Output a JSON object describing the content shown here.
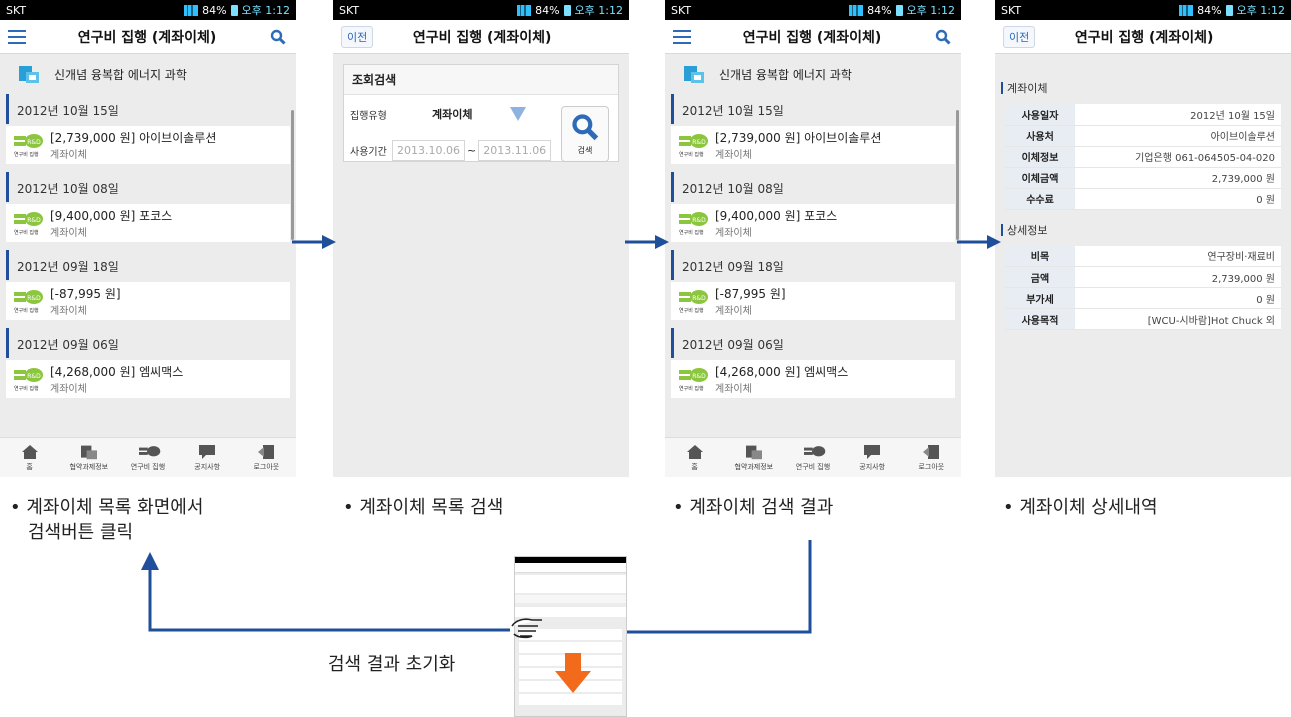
{
  "status": {
    "carrier": "SKT",
    "battery": "84%",
    "time": "오후 1:12"
  },
  "list_screen": {
    "title": "연구비 집행 (계좌이체)",
    "project": "신개념 융복합 에너지 과학",
    "groups": [
      {
        "date": "2012년 10월 15일",
        "amount": "[2,739,000 원] 아이브이솔루션",
        "type": "계좌이체"
      },
      {
        "date": "2012년 10월 08일",
        "amount": "[9,400,000 원] 포코스",
        "type": "계좌이체"
      },
      {
        "date": "2012년 09월 18일",
        "amount": "[-87,995 원]",
        "type": "계좌이체"
      },
      {
        "date": "2012년 09월 06일",
        "amount": "[4,268,000 원] 엠씨맥스",
        "type": "계좌이체"
      }
    ],
    "badge": "연구비 집행"
  },
  "nav": [
    {
      "label": "홈",
      "icon": "home-icon"
    },
    {
      "label": "협약과제정보",
      "icon": "project-info-icon"
    },
    {
      "label": "연구비 집행",
      "icon": "rnd-expense-icon"
    },
    {
      "label": "공지사항",
      "icon": "notice-icon"
    },
    {
      "label": "로그아웃",
      "icon": "logout-icon"
    }
  ],
  "search_screen": {
    "back": "이전",
    "title": "연구비 집행 (계좌이체)",
    "panel_title": "조회검색",
    "type_label": "집행유형",
    "type_value": "계좌이체",
    "period_label": "사용기간",
    "date_from": "2013.10.06",
    "tilde": "~",
    "date_to": "2013.11.06",
    "search_btn": "검색"
  },
  "detail_screen": {
    "back": "이전",
    "title": "연구비 집행 (계좌이체)",
    "section1": "계좌이체",
    "rows1": [
      {
        "k": "사용일자",
        "v": "2012년 10월 15일"
      },
      {
        "k": "사용처",
        "v": "아이브이솔루션"
      },
      {
        "k": "이체정보",
        "v": "기업은행 061-064505-04-020"
      },
      {
        "k": "이체금액",
        "v": "2,739,000 원"
      },
      {
        "k": "수수료",
        "v": "0 원"
      }
    ],
    "section2": "상세정보",
    "rows2": [
      {
        "k": "비목",
        "v": "연구장비·재료비"
      },
      {
        "k": "금액",
        "v": "2,739,000 원"
      },
      {
        "k": "부가세",
        "v": "0 원"
      },
      {
        "k": "사용목적",
        "v": "[WCU-시바람]Hot Chuck 외"
      }
    ]
  },
  "captions": {
    "c1_line1": "• 계좌이체 목록 화면에서",
    "c1_line2": "검색버튼 클릭",
    "c2": "• 계좌이체 목록 검색",
    "c3": "• 계좌이체 검색 결과",
    "c4": "• 계좌이체 상세내역",
    "reset": "검색 결과 초기화"
  },
  "colors": {
    "accent": "#2d6ab8",
    "arrow": "#1f4e9a",
    "down_arrow": "#f26b1d"
  }
}
